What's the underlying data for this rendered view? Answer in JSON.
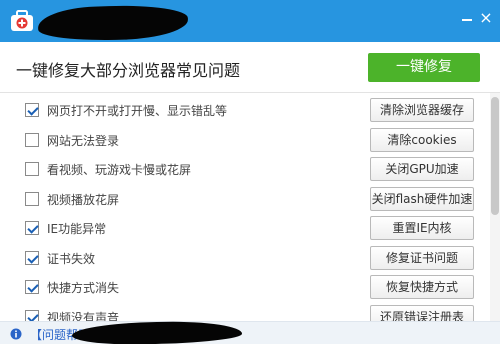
{
  "titlebar": {
    "close_glyph": "×"
  },
  "header": {
    "headline": "一键修复大部分浏览器常见问题",
    "fix_all_button": "一键修复"
  },
  "issues": [
    {
      "label": "网页打不开或打开慢、显示错乱等",
      "checked": true,
      "action": "清除浏览器缓存"
    },
    {
      "label": "网站无法登录",
      "checked": false,
      "action": "清除cookies"
    },
    {
      "label": "看视频、玩游戏卡慢或花屏",
      "checked": false,
      "action": "关闭GPU加速"
    },
    {
      "label": "视频播放花屏",
      "checked": false,
      "action": "关闭flash硬件加速"
    },
    {
      "label": "IE功能异常",
      "checked": true,
      "action": "重置IE内核"
    },
    {
      "label": "证书失效",
      "checked": true,
      "action": "修复证书问题"
    },
    {
      "label": "快捷方式消失",
      "checked": true,
      "action": "恢复快捷方式"
    },
    {
      "label": "视频没有声音",
      "checked": true,
      "action": "还原错误注册表"
    }
  ],
  "footer": {
    "link_text": "【问题帮助】"
  },
  "colors": {
    "titlebar": "#2795e0",
    "fix_button": "#4cb32a",
    "check_mark": "#1a5fb4",
    "logo_red": "#e53935"
  }
}
